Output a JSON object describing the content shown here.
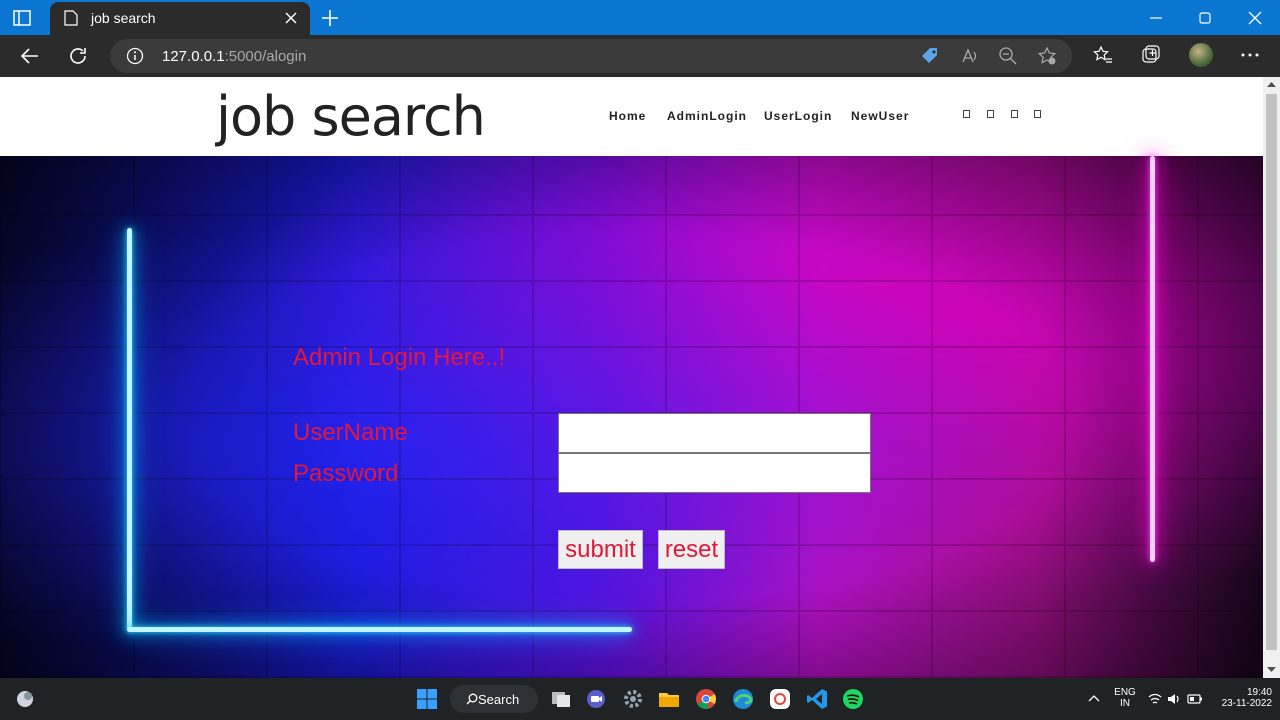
{
  "browser": {
    "tab_title": "job search",
    "url_host": "127.0.0.1",
    "url_rest": ":5000/alogin"
  },
  "site": {
    "brand": "job search",
    "nav": [
      {
        "label": "Home"
      },
      {
        "label": "AdminLogin"
      },
      {
        "label": "UserLogin"
      },
      {
        "label": "NewUser"
      }
    ]
  },
  "form": {
    "title": "Admin Login Here..!",
    "username_label": "UserName",
    "password_label": "Password",
    "username_value": "",
    "password_value": "",
    "submit_label": "submit",
    "reset_label": "reset"
  },
  "taskbar": {
    "search_label": "Search",
    "lang_top": "ENG",
    "lang_bottom": "IN",
    "time": "19:40",
    "date": "23-11-2022"
  },
  "colors": {
    "form_text": "#e1183a",
    "titlebar": "#0b77d3"
  }
}
